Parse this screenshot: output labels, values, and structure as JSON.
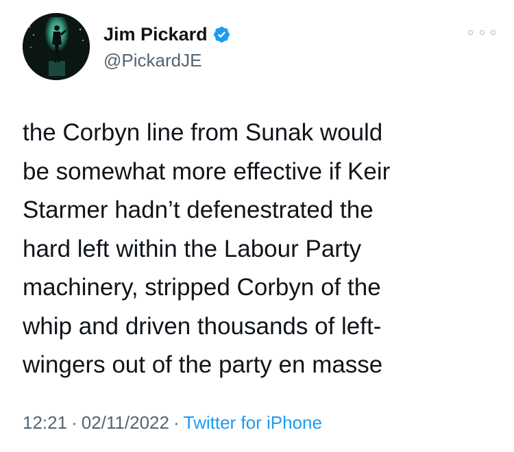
{
  "author": {
    "display_name": "Jim Pickard",
    "handle": "@PickardJE",
    "verified": true,
    "avatar": "avatar-silhouette-on-stage"
  },
  "menu": {
    "icon": "more-options-icon"
  },
  "tweet": {
    "lines": [
      "the Corbyn line from Sunak would",
      "be somewhat more effective if Keir",
      "Starmer hadn’t defenestrated the",
      "hard left within the Labour Party",
      "machinery, stripped Corbyn of the",
      "whip and driven thousands of left-",
      "wingers out of the party en masse"
    ]
  },
  "meta": {
    "time": "12:21",
    "separator": "·",
    "date": "02/11/2022",
    "source": "Twitter for iPhone"
  },
  "colors": {
    "text": "#0f1419",
    "secondary": "#536471",
    "link": "#1d9bf0",
    "verified_badge": "#1d9bf0"
  }
}
